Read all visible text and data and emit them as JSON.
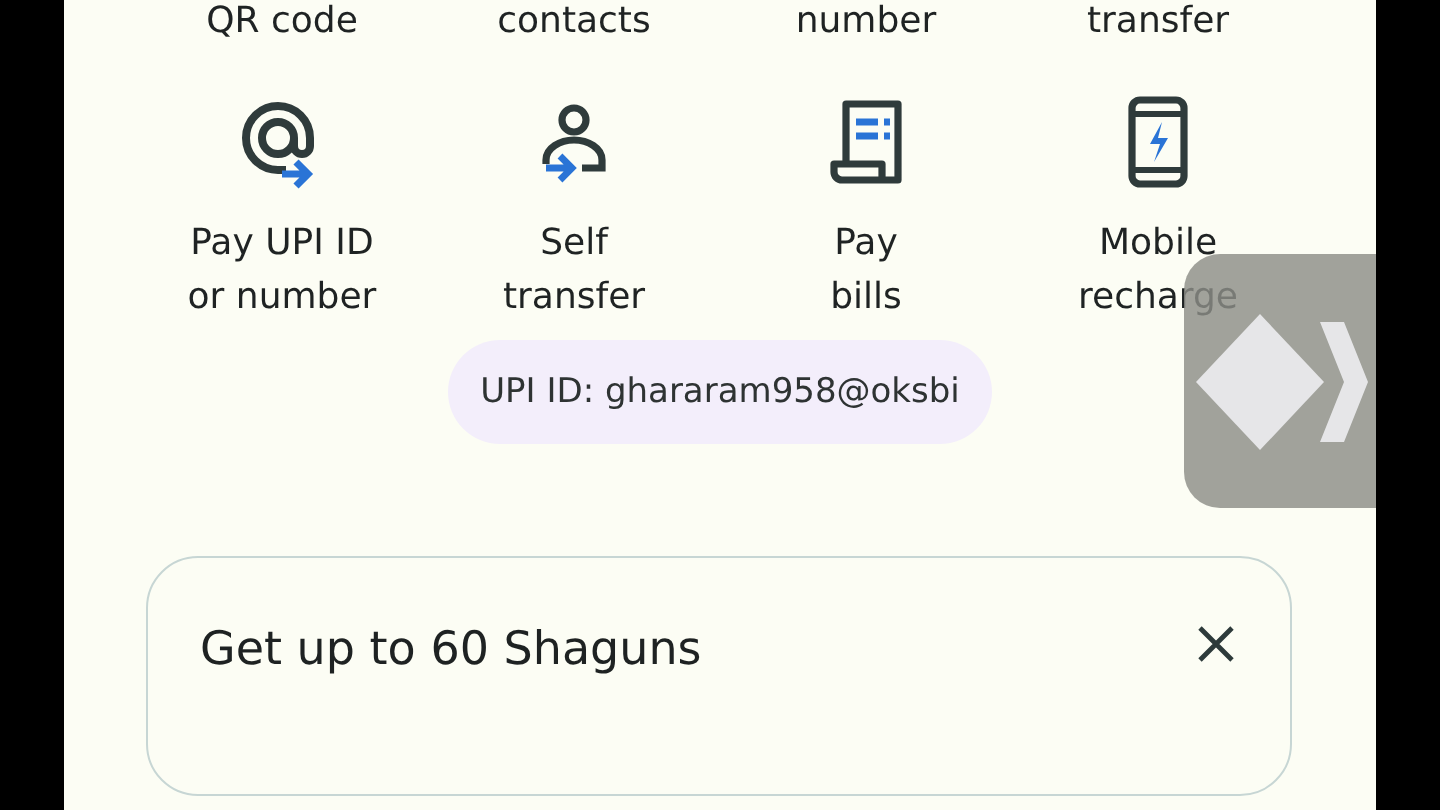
{
  "previous_row_labels": [
    "QR code",
    "contacts",
    "number",
    "transfer"
  ],
  "actions": [
    {
      "label": "Pay UPI ID\nor number"
    },
    {
      "label": "Self\ntransfer"
    },
    {
      "label": "Pay\nbills"
    },
    {
      "label": "Mobile\nrecharge"
    }
  ],
  "upi_id": "UPI ID: ghararam958@oksbi",
  "promo_card": {
    "title": "Get up to 60 Shaguns"
  }
}
